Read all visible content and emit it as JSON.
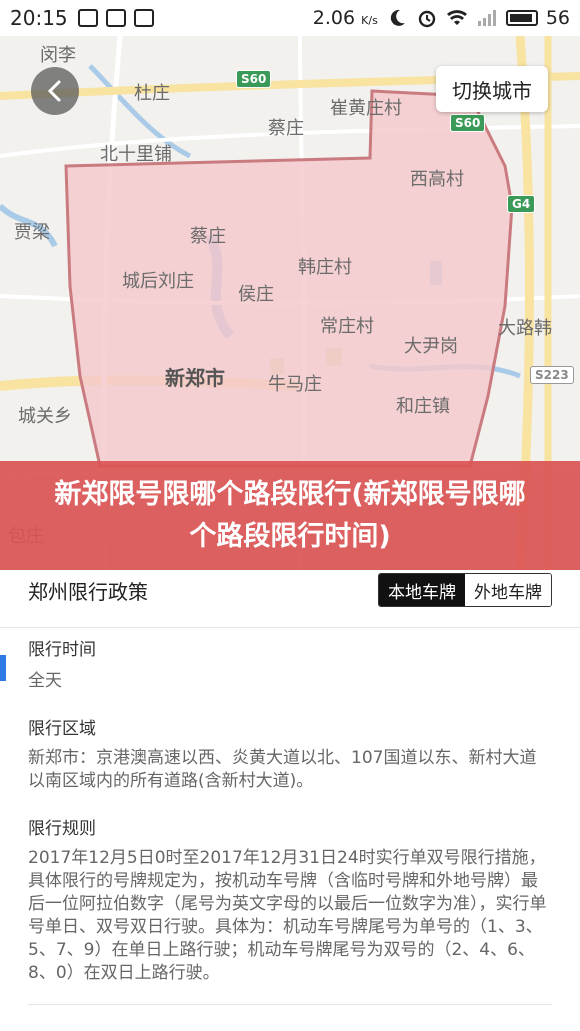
{
  "status_bar": {
    "time": "20:15",
    "speed": "2.06",
    "speed_unit": "K/s",
    "battery": "56"
  },
  "map": {
    "switch_city_label": "切换城市",
    "labels": {
      "nanli": "闵李",
      "duzhuang": "杜庄",
      "caizhuang_n": "蔡庄",
      "cuihuangzhuangcun": "崔黄庄村",
      "beishilipu": "北十里铺",
      "xigaocun": "西高村",
      "jialiang": "贾梁",
      "caizhuang": "蔡庄",
      "hanzhuangcun": "韩庄村",
      "chenghouliuzhuang": "城后刘庄",
      "houzhuang": "侯庄",
      "changzhuangcun": "常庄村",
      "dalu": "大路韩",
      "dayingang": "大尹岗",
      "xinzheng": "新郑市",
      "niumazhuang": "牛马庄",
      "chengguanxiang": "城关乡",
      "hezhuangzhen": "和庄镇",
      "baozhuang": "包庄"
    },
    "shields": {
      "s60_a": "S60",
      "s60_b": "S60",
      "g4": "G4",
      "s223": "S223"
    }
  },
  "headline": "新郑限号限哪个路段限行(新郑限号限哪个路段限行时间)",
  "policy": {
    "title": "郑州限行政策",
    "tabs": [
      "本地车牌",
      "外地车牌"
    ]
  },
  "sections": {
    "time_label": "限行时间",
    "time_value": "全天",
    "area_label": "限行区域",
    "area_value": "新郑市：京港澳高速以西、炎黄大道以北、107国道以东、新村大道以南区域内的所有道路(含新村大道)。",
    "rule_label": "限行规则",
    "rule_value": "2017年12月5日0时至2017年12月31日24时实行单双号限行措施，具体限行的号牌规定为，按机动车号牌（含临时号牌和外地号牌）最后一位阿拉伯数字（尾号为英文字母的以最后一位数字为准），实行单号单日、双号双日行驶。具体为：机动车号牌尾号为单号的（1、3、5、7、9）在单日上路行驶；机动车号牌尾号为双号的（2、4、6、8、0）在双日上路行驶。"
  },
  "colors": {
    "banner": "#db5454",
    "zone_fill": "#f4c8cc",
    "zone_stroke": "#c97b80",
    "active_tab": "#111111",
    "side_marker": "#2f7ae5"
  }
}
